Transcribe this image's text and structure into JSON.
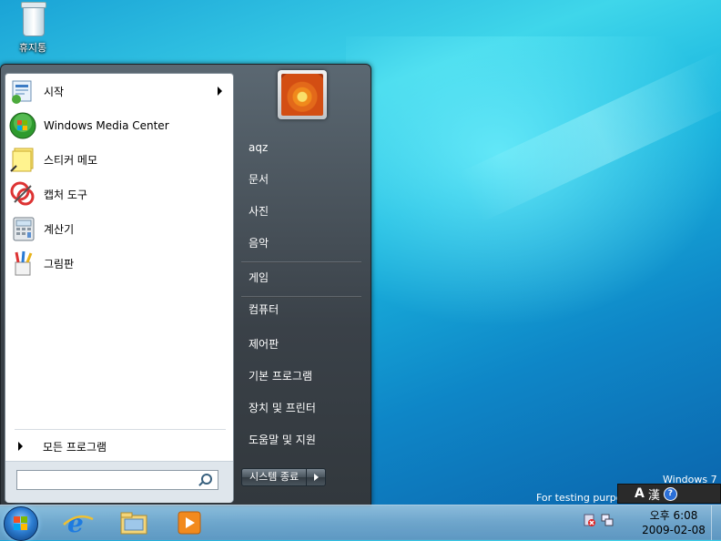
{
  "desktop": {
    "recycle_bin_label": "휴지통",
    "watermark_line1": "Windows 7",
    "watermark_line2": "For testing purposes only"
  },
  "start_menu": {
    "programs": [
      {
        "label": "시작",
        "icon": "getting-started-icon",
        "has_submenu": true
      },
      {
        "label": "Windows Media Center",
        "icon": "media-center-icon",
        "has_submenu": false
      },
      {
        "label": "스티커 메모",
        "icon": "sticky-notes-icon",
        "has_submenu": false
      },
      {
        "label": "캡처 도구",
        "icon": "snipping-tool-icon",
        "has_submenu": false
      },
      {
        "label": "계산기",
        "icon": "calculator-icon",
        "has_submenu": false
      },
      {
        "label": "그림판",
        "icon": "paint-icon",
        "has_submenu": false
      }
    ],
    "all_programs_label": "모든 프로그램",
    "search": {
      "value": "",
      "placeholder": ""
    },
    "right": {
      "user": "aqz",
      "documents": "문서",
      "pictures": "사진",
      "music": "음악",
      "games": "게임",
      "computer": "컴퓨터",
      "control_panel": "제어판",
      "default_programs": "기본 프로그램",
      "devices_printers": "장치 및 프린터",
      "help_support": "도움말 및 지원"
    },
    "shutdown_label": "시스템 종료"
  },
  "langbar": {
    "mode": "A",
    "hanja": "漢",
    "help": "?"
  },
  "taskbar": {
    "pinned": [
      "internet-explorer-icon",
      "windows-explorer-icon",
      "media-player-icon"
    ],
    "clock_time": "오후 6:08",
    "clock_date": "2009-02-08"
  }
}
